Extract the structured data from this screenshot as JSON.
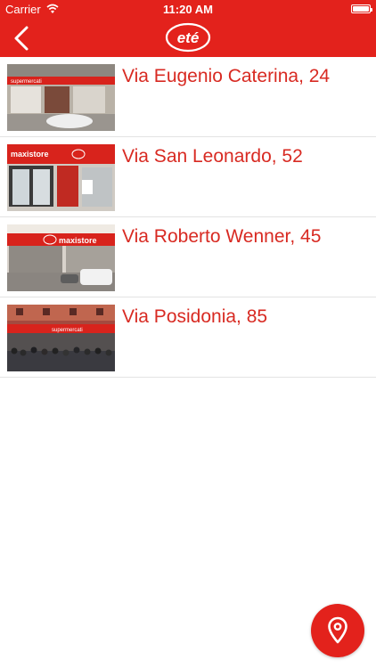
{
  "status_bar": {
    "carrier": "Carrier",
    "time": "11:20 AM"
  },
  "header": {
    "logo_text": "eté",
    "back_icon": "chevron-left-icon"
  },
  "stores": [
    {
      "address": "Via Eugenio Caterina, 24",
      "sign": "supermercati"
    },
    {
      "address": "Via San Leonardo, 52",
      "sign": "maxistore"
    },
    {
      "address": "Via Roberto Wenner, 45",
      "sign": "maxistore"
    },
    {
      "address": "Via Posidonia, 85",
      "sign": "supermercati"
    }
  ],
  "fab": {
    "icon": "map-pin-icon"
  },
  "colors": {
    "brand_red": "#e3221c",
    "address_red": "#d82a22"
  }
}
